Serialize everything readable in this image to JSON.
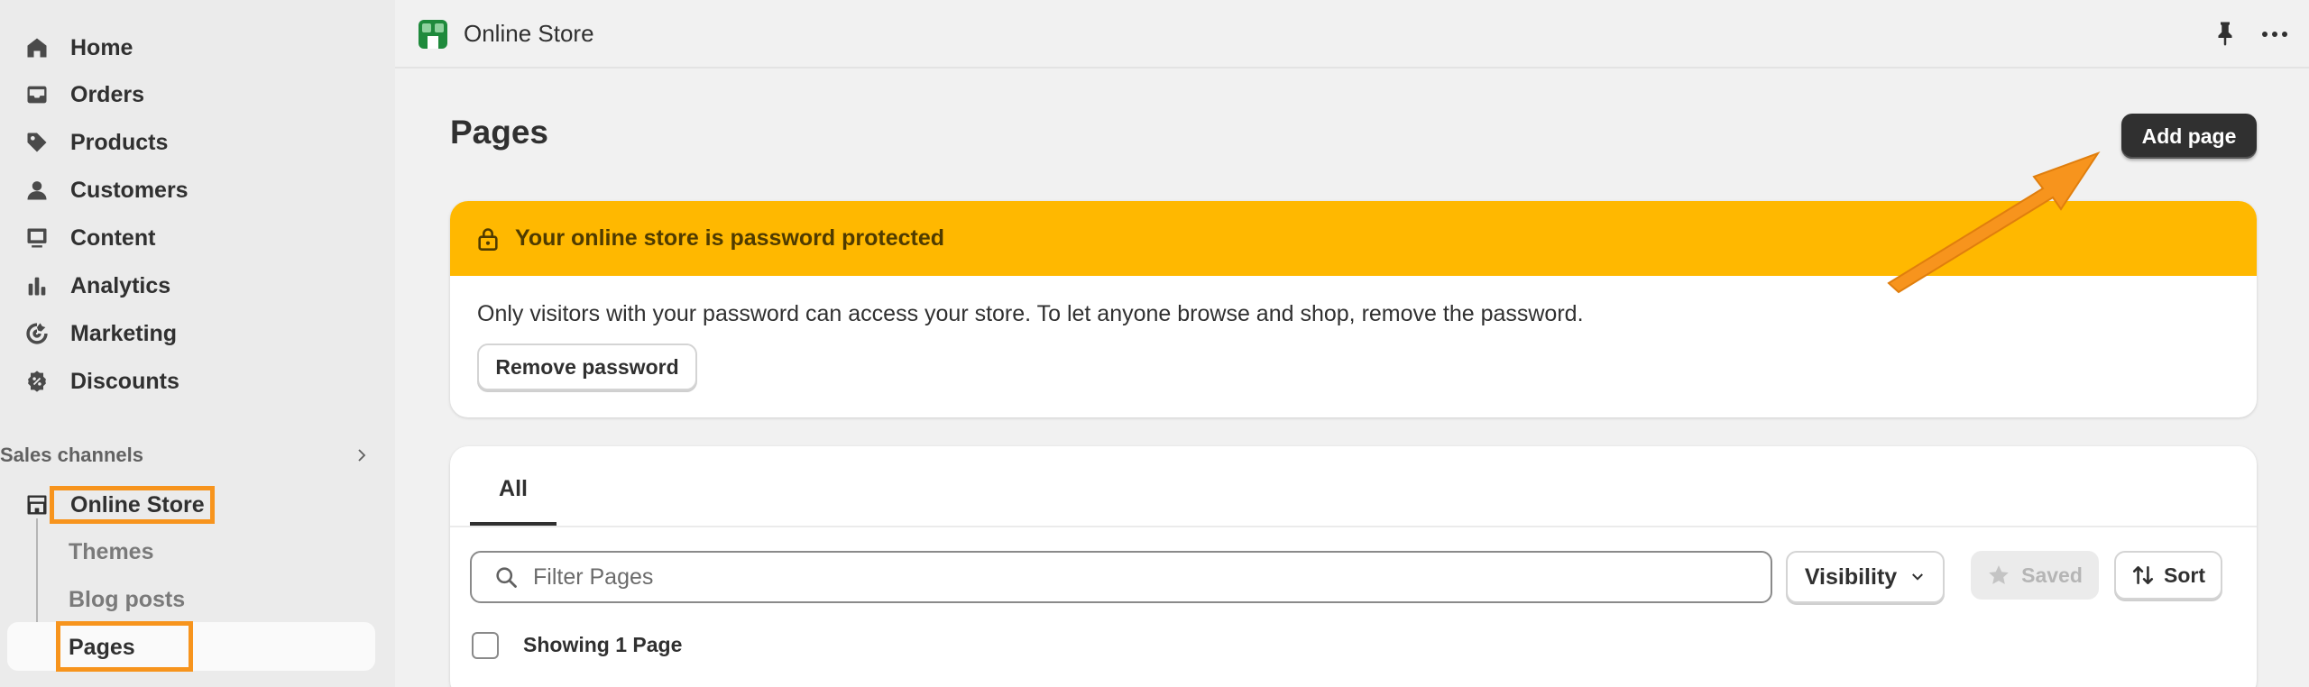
{
  "sidebar": {
    "items": [
      {
        "label": "Home",
        "icon": "home-icon"
      },
      {
        "label": "Orders",
        "icon": "inbox-icon"
      },
      {
        "label": "Products",
        "icon": "tag-icon"
      },
      {
        "label": "Customers",
        "icon": "person-icon"
      },
      {
        "label": "Content",
        "icon": "content-icon"
      },
      {
        "label": "Analytics",
        "icon": "bar-chart-icon"
      },
      {
        "label": "Marketing",
        "icon": "target-icon"
      },
      {
        "label": "Discounts",
        "icon": "discount-icon"
      }
    ],
    "sales_channels_label": "Sales channels",
    "online_store_label": "Online Store",
    "sub_items": [
      "Themes",
      "Blog posts",
      "Pages"
    ]
  },
  "topbar": {
    "app_title": "Online Store"
  },
  "main": {
    "page_title": "Pages",
    "add_button": "Add page",
    "banner": {
      "title": "Your online store is password protected",
      "message": "Only visitors with your password can access your store. To let anyone browse and shop, remove the password.",
      "button": "Remove password"
    },
    "tabs": [
      {
        "label": "All"
      }
    ],
    "filter": {
      "placeholder": "Filter Pages"
    },
    "visibility_label": "Visibility",
    "saved_label": "Saved",
    "sort_label": "Sort",
    "showing_label": "Showing 1 Page"
  },
  "colors": {
    "banner_warning": "#ffb800",
    "annotation": "#f7941d",
    "primary_button": "#303030"
  }
}
